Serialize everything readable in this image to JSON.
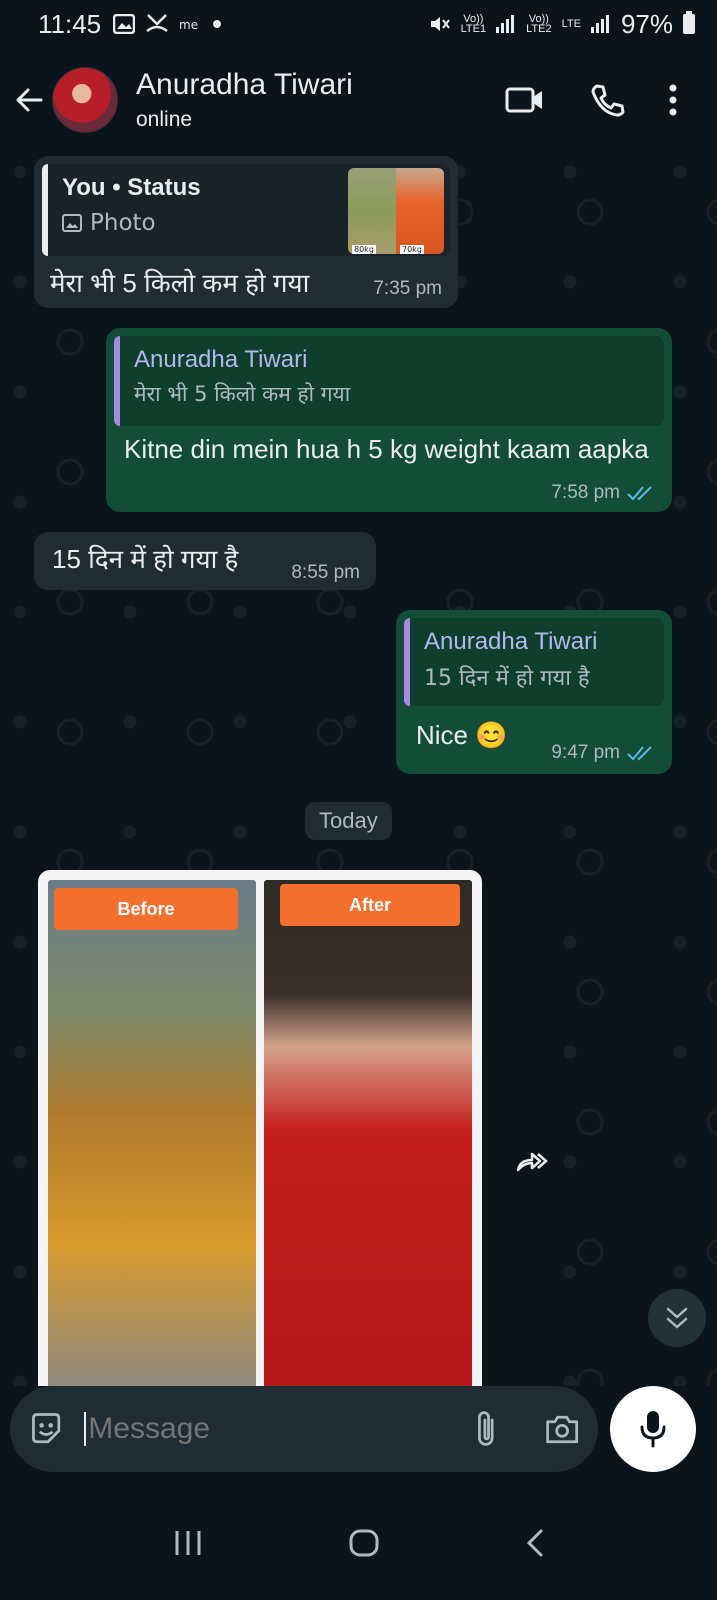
{
  "status_bar": {
    "time": "11:45",
    "battery": "97%",
    "net1_top": "Vo))",
    "net1_bottom": "LTE1",
    "net2_top": "Vo))",
    "net2_bottom": "LTE2",
    "lte": "LTE"
  },
  "header": {
    "contact_name": "Anuradha Tiwari",
    "presence": "online"
  },
  "messages": [
    {
      "direction": "in",
      "quote_author": "You • Status",
      "quote_text": "Photo",
      "text": "मेरा भी 5 किलो कम हो गया",
      "time": "7:35 pm",
      "thumb_labels": [
        "80kg",
        "70kg"
      ]
    },
    {
      "direction": "out",
      "quote_author": "Anuradha Tiwari",
      "quote_text": "मेरा भी 5 किलो कम हो गया",
      "text": "Kitne din mein hua h 5 kg weight kaam aapka",
      "time": "7:58 pm"
    },
    {
      "direction": "in",
      "text": "15 दिन में हो गया है",
      "time": "8:55 pm"
    },
    {
      "direction": "out",
      "quote_author": "Anuradha Tiwari",
      "quote_text": "15 दिन में हो गया है",
      "text": "Nice 😊",
      "time": "9:47 pm"
    }
  ],
  "date_divider": "Today",
  "photo_message": {
    "before_label": "Before",
    "after_label": "After"
  },
  "composer": {
    "placeholder": "Message"
  },
  "colors": {
    "background": "#0b141a",
    "incoming_bubble": "#202c33",
    "outgoing_bubble": "#134d37",
    "read_tick": "#53bdeb",
    "tag_orange": "#f26f2d"
  }
}
